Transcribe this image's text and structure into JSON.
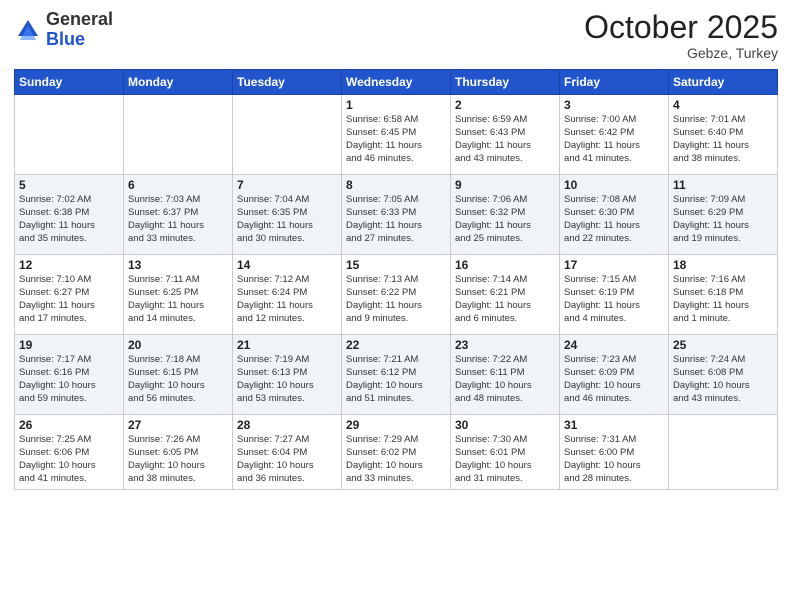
{
  "header": {
    "logo_general": "General",
    "logo_blue": "Blue",
    "month": "October 2025",
    "location": "Gebze, Turkey"
  },
  "weekdays": [
    "Sunday",
    "Monday",
    "Tuesday",
    "Wednesday",
    "Thursday",
    "Friday",
    "Saturday"
  ],
  "weeks": [
    [
      {
        "day": "",
        "info": ""
      },
      {
        "day": "",
        "info": ""
      },
      {
        "day": "",
        "info": ""
      },
      {
        "day": "1",
        "info": "Sunrise: 6:58 AM\nSunset: 6:45 PM\nDaylight: 11 hours\nand 46 minutes."
      },
      {
        "day": "2",
        "info": "Sunrise: 6:59 AM\nSunset: 6:43 PM\nDaylight: 11 hours\nand 43 minutes."
      },
      {
        "day": "3",
        "info": "Sunrise: 7:00 AM\nSunset: 6:42 PM\nDaylight: 11 hours\nand 41 minutes."
      },
      {
        "day": "4",
        "info": "Sunrise: 7:01 AM\nSunset: 6:40 PM\nDaylight: 11 hours\nand 38 minutes."
      }
    ],
    [
      {
        "day": "5",
        "info": "Sunrise: 7:02 AM\nSunset: 6:38 PM\nDaylight: 11 hours\nand 35 minutes."
      },
      {
        "day": "6",
        "info": "Sunrise: 7:03 AM\nSunset: 6:37 PM\nDaylight: 11 hours\nand 33 minutes."
      },
      {
        "day": "7",
        "info": "Sunrise: 7:04 AM\nSunset: 6:35 PM\nDaylight: 11 hours\nand 30 minutes."
      },
      {
        "day": "8",
        "info": "Sunrise: 7:05 AM\nSunset: 6:33 PM\nDaylight: 11 hours\nand 27 minutes."
      },
      {
        "day": "9",
        "info": "Sunrise: 7:06 AM\nSunset: 6:32 PM\nDaylight: 11 hours\nand 25 minutes."
      },
      {
        "day": "10",
        "info": "Sunrise: 7:08 AM\nSunset: 6:30 PM\nDaylight: 11 hours\nand 22 minutes."
      },
      {
        "day": "11",
        "info": "Sunrise: 7:09 AM\nSunset: 6:29 PM\nDaylight: 11 hours\nand 19 minutes."
      }
    ],
    [
      {
        "day": "12",
        "info": "Sunrise: 7:10 AM\nSunset: 6:27 PM\nDaylight: 11 hours\nand 17 minutes."
      },
      {
        "day": "13",
        "info": "Sunrise: 7:11 AM\nSunset: 6:25 PM\nDaylight: 11 hours\nand 14 minutes."
      },
      {
        "day": "14",
        "info": "Sunrise: 7:12 AM\nSunset: 6:24 PM\nDaylight: 11 hours\nand 12 minutes."
      },
      {
        "day": "15",
        "info": "Sunrise: 7:13 AM\nSunset: 6:22 PM\nDaylight: 11 hours\nand 9 minutes."
      },
      {
        "day": "16",
        "info": "Sunrise: 7:14 AM\nSunset: 6:21 PM\nDaylight: 11 hours\nand 6 minutes."
      },
      {
        "day": "17",
        "info": "Sunrise: 7:15 AM\nSunset: 6:19 PM\nDaylight: 11 hours\nand 4 minutes."
      },
      {
        "day": "18",
        "info": "Sunrise: 7:16 AM\nSunset: 6:18 PM\nDaylight: 11 hours\nand 1 minute."
      }
    ],
    [
      {
        "day": "19",
        "info": "Sunrise: 7:17 AM\nSunset: 6:16 PM\nDaylight: 10 hours\nand 59 minutes."
      },
      {
        "day": "20",
        "info": "Sunrise: 7:18 AM\nSunset: 6:15 PM\nDaylight: 10 hours\nand 56 minutes."
      },
      {
        "day": "21",
        "info": "Sunrise: 7:19 AM\nSunset: 6:13 PM\nDaylight: 10 hours\nand 53 minutes."
      },
      {
        "day": "22",
        "info": "Sunrise: 7:21 AM\nSunset: 6:12 PM\nDaylight: 10 hours\nand 51 minutes."
      },
      {
        "day": "23",
        "info": "Sunrise: 7:22 AM\nSunset: 6:11 PM\nDaylight: 10 hours\nand 48 minutes."
      },
      {
        "day": "24",
        "info": "Sunrise: 7:23 AM\nSunset: 6:09 PM\nDaylight: 10 hours\nand 46 minutes."
      },
      {
        "day": "25",
        "info": "Sunrise: 7:24 AM\nSunset: 6:08 PM\nDaylight: 10 hours\nand 43 minutes."
      }
    ],
    [
      {
        "day": "26",
        "info": "Sunrise: 7:25 AM\nSunset: 6:06 PM\nDaylight: 10 hours\nand 41 minutes."
      },
      {
        "day": "27",
        "info": "Sunrise: 7:26 AM\nSunset: 6:05 PM\nDaylight: 10 hours\nand 38 minutes."
      },
      {
        "day": "28",
        "info": "Sunrise: 7:27 AM\nSunset: 6:04 PM\nDaylight: 10 hours\nand 36 minutes."
      },
      {
        "day": "29",
        "info": "Sunrise: 7:29 AM\nSunset: 6:02 PM\nDaylight: 10 hours\nand 33 minutes."
      },
      {
        "day": "30",
        "info": "Sunrise: 7:30 AM\nSunset: 6:01 PM\nDaylight: 10 hours\nand 31 minutes."
      },
      {
        "day": "31",
        "info": "Sunrise: 7:31 AM\nSunset: 6:00 PM\nDaylight: 10 hours\nand 28 minutes."
      },
      {
        "day": "",
        "info": ""
      }
    ]
  ]
}
